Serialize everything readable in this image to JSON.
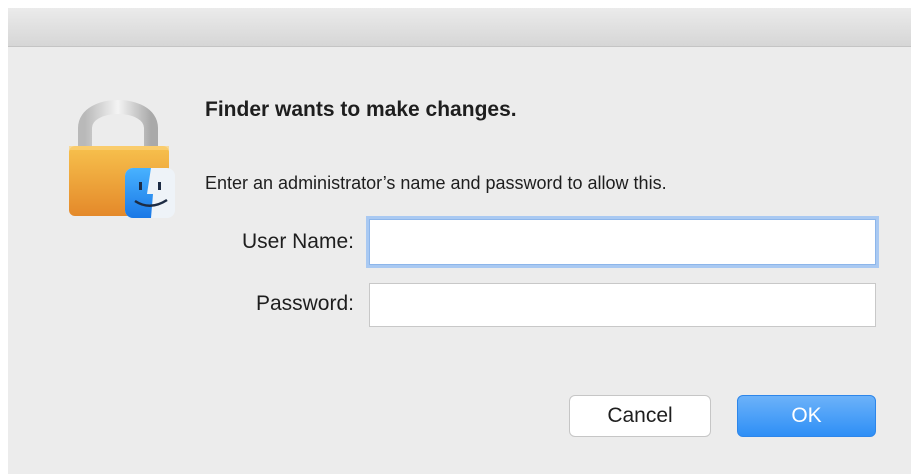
{
  "dialog": {
    "title": "Finder wants to make changes.",
    "message": "Enter an administrator’s name and password to allow this.",
    "icon": "lock-with-finder-icon"
  },
  "fields": {
    "username": {
      "label": "User Name:",
      "value": "",
      "placeholder": ""
    },
    "password": {
      "label": "Password:",
      "value": "",
      "placeholder": ""
    }
  },
  "buttons": {
    "cancel_label": "Cancel",
    "ok_label": "OK"
  },
  "colors": {
    "accent": "#3a93f7",
    "window_background": "#ececec",
    "lock_gold": "#f1a93a",
    "finder_blue": "#2e8cf0"
  }
}
